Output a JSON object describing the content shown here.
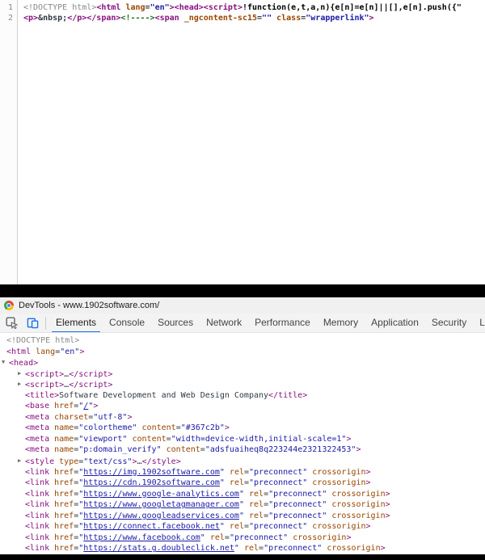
{
  "source_view": {
    "lines": [
      {
        "n": "1",
        "segs": [
          [
            "d",
            "<!DOCTYPE html>"
          ],
          [
            "t",
            "<html "
          ],
          [
            "a",
            "lang"
          ],
          [
            "x",
            "="
          ],
          [
            "v",
            "\"en\""
          ],
          [
            "t",
            "><head><script>"
          ],
          [
            "b",
            "!function(e,t,a,n){e[n]=e[n]||[],e[n].push({\""
          ]
        ]
      },
      {
        "n": "2",
        "segs": [
          [
            "t",
            "<p>"
          ],
          [
            "x",
            "&nbsp;"
          ],
          [
            "t",
            "</p></span>"
          ],
          [
            "c",
            "<!---->"
          ],
          [
            "t",
            "<span "
          ],
          [
            "a",
            "_ngcontent-sc15"
          ],
          [
            "x",
            "="
          ],
          [
            "v",
            "\"\""
          ],
          [
            "x",
            " "
          ],
          [
            "a",
            "class"
          ],
          [
            "x",
            "="
          ],
          [
            "v",
            "\"wrapperlink\""
          ],
          [
            "t",
            ">"
          ]
        ]
      }
    ]
  },
  "titlebar": {
    "title": "DevTools - www.1902software.com/",
    "icon": "chrome-logo-icon"
  },
  "tabbar": {
    "icons": [
      {
        "name": "inspect-element-icon",
        "color": "#5f6368"
      },
      {
        "name": "device-toolbar-icon",
        "color": "#1a73e8"
      }
    ],
    "tabs": [
      {
        "label": "Elements",
        "selected": true
      },
      {
        "label": "Console"
      },
      {
        "label": "Sources"
      },
      {
        "label": "Network"
      },
      {
        "label": "Performance"
      },
      {
        "label": "Memory"
      },
      {
        "label": "Application"
      },
      {
        "label": "Security"
      },
      {
        "label": "Lighthouse"
      }
    ],
    "accent_color": "#1a73e8"
  },
  "elements_panel": {
    "rows": [
      {
        "pl": 8,
        "arrow": "",
        "segs": [
          [
            "d",
            "<!DOCTYPE html>"
          ]
        ]
      },
      {
        "pl": 8,
        "arrow": "",
        "segs": [
          [
            "t",
            "<html "
          ],
          [
            "a",
            "lang"
          ],
          [
            "x",
            "="
          ],
          [
            "v",
            "\"en\""
          ],
          [
            "t",
            ">"
          ]
        ]
      },
      {
        "pl": 2,
        "arrow": "v",
        "segs": [
          [
            "t",
            "<head>"
          ]
        ]
      },
      {
        "pl": 22,
        "arrow": ">",
        "segs": [
          [
            "t",
            "<script>"
          ],
          [
            "x",
            "…"
          ],
          [
            "t",
            "</script>"
          ]
        ]
      },
      {
        "pl": 22,
        "arrow": ">",
        "segs": [
          [
            "t",
            "<script>"
          ],
          [
            "x",
            "…"
          ],
          [
            "t",
            "</script>"
          ]
        ]
      },
      {
        "pl": 31,
        "arrow": "",
        "segs": [
          [
            "t",
            "<title>"
          ],
          [
            "x",
            "Software Development and Web Design Company"
          ],
          [
            "t",
            "</title>"
          ]
        ]
      },
      {
        "pl": 31,
        "arrow": "",
        "segs": [
          [
            "t",
            "<base "
          ],
          [
            "a",
            "href"
          ],
          [
            "x",
            "="
          ],
          [
            "v",
            "\""
          ],
          [
            "l",
            "/"
          ],
          [
            "v",
            "\""
          ],
          [
            "t",
            ">"
          ]
        ]
      },
      {
        "pl": 31,
        "arrow": "",
        "segs": [
          [
            "t",
            "<meta "
          ],
          [
            "a",
            "charset"
          ],
          [
            "x",
            "="
          ],
          [
            "v",
            "\"utf-8\""
          ],
          [
            "t",
            ">"
          ]
        ]
      },
      {
        "pl": 31,
        "arrow": "",
        "segs": [
          [
            "t",
            "<meta "
          ],
          [
            "a",
            "name"
          ],
          [
            "x",
            "="
          ],
          [
            "v",
            "\"colortheme\""
          ],
          [
            "x",
            " "
          ],
          [
            "a",
            "content"
          ],
          [
            "x",
            "="
          ],
          [
            "v",
            "\"#367c2b\""
          ],
          [
            "t",
            ">"
          ]
        ]
      },
      {
        "pl": 31,
        "arrow": "",
        "segs": [
          [
            "t",
            "<meta "
          ],
          [
            "a",
            "name"
          ],
          [
            "x",
            "="
          ],
          [
            "v",
            "\"viewport\""
          ],
          [
            "x",
            " "
          ],
          [
            "a",
            "content"
          ],
          [
            "x",
            "="
          ],
          [
            "v",
            "\"width=device-width,initial-scale=1\""
          ],
          [
            "t",
            ">"
          ]
        ]
      },
      {
        "pl": 31,
        "arrow": "",
        "segs": [
          [
            "t",
            "<meta "
          ],
          [
            "a",
            "name"
          ],
          [
            "x",
            "="
          ],
          [
            "v",
            "\"p:domain_verify\""
          ],
          [
            "x",
            " "
          ],
          [
            "a",
            "content"
          ],
          [
            "x",
            "="
          ],
          [
            "v",
            "\"adsfuaiheq8q223244e2321322453\""
          ],
          [
            "t",
            ">"
          ]
        ]
      },
      {
        "pl": 22,
        "arrow": ">",
        "segs": [
          [
            "t",
            "<style "
          ],
          [
            "a",
            "type"
          ],
          [
            "x",
            "="
          ],
          [
            "v",
            "\"text/css\""
          ],
          [
            "t",
            ">"
          ],
          [
            "x",
            "…"
          ],
          [
            "t",
            "</style>"
          ]
        ]
      },
      {
        "pl": 31,
        "arrow": "",
        "segs": [
          [
            "t",
            "<link "
          ],
          [
            "a",
            "href"
          ],
          [
            "x",
            "="
          ],
          [
            "v",
            "\""
          ],
          [
            "l",
            "https://img.1902software.com"
          ],
          [
            "v",
            "\""
          ],
          [
            "x",
            " "
          ],
          [
            "a",
            "rel"
          ],
          [
            "x",
            "="
          ],
          [
            "v",
            "\"preconnect\""
          ],
          [
            "x",
            " "
          ],
          [
            "a",
            "crossorigin"
          ],
          [
            "t",
            ">"
          ]
        ]
      },
      {
        "pl": 31,
        "arrow": "",
        "segs": [
          [
            "t",
            "<link "
          ],
          [
            "a",
            "href"
          ],
          [
            "x",
            "="
          ],
          [
            "v",
            "\""
          ],
          [
            "l",
            "https://cdn.1902software.com"
          ],
          [
            "v",
            "\""
          ],
          [
            "x",
            " "
          ],
          [
            "a",
            "rel"
          ],
          [
            "x",
            "="
          ],
          [
            "v",
            "\"preconnect\""
          ],
          [
            "x",
            " "
          ],
          [
            "a",
            "crossorigin"
          ],
          [
            "t",
            ">"
          ]
        ]
      },
      {
        "pl": 31,
        "arrow": "",
        "segs": [
          [
            "t",
            "<link "
          ],
          [
            "a",
            "href"
          ],
          [
            "x",
            "="
          ],
          [
            "v",
            "\""
          ],
          [
            "l",
            "https://www.google-analytics.com"
          ],
          [
            "v",
            "\""
          ],
          [
            "x",
            " "
          ],
          [
            "a",
            "rel"
          ],
          [
            "x",
            "="
          ],
          [
            "v",
            "\"preconnect\""
          ],
          [
            "x",
            " "
          ],
          [
            "a",
            "crossorigin"
          ],
          [
            "t",
            ">"
          ]
        ]
      },
      {
        "pl": 31,
        "arrow": "",
        "segs": [
          [
            "t",
            "<link "
          ],
          [
            "a",
            "href"
          ],
          [
            "x",
            "="
          ],
          [
            "v",
            "\""
          ],
          [
            "l",
            "https://www.googletagmanager.com"
          ],
          [
            "v",
            "\""
          ],
          [
            "x",
            " "
          ],
          [
            "a",
            "rel"
          ],
          [
            "x",
            "="
          ],
          [
            "v",
            "\"preconnect\""
          ],
          [
            "x",
            " "
          ],
          [
            "a",
            "crossorigin"
          ],
          [
            "t",
            ">"
          ]
        ]
      },
      {
        "pl": 31,
        "arrow": "",
        "segs": [
          [
            "t",
            "<link "
          ],
          [
            "a",
            "href"
          ],
          [
            "x",
            "="
          ],
          [
            "v",
            "\""
          ],
          [
            "l",
            "https://www.googleadservices.com"
          ],
          [
            "v",
            "\""
          ],
          [
            "x",
            " "
          ],
          [
            "a",
            "rel"
          ],
          [
            "x",
            "="
          ],
          [
            "v",
            "\"preconnect\""
          ],
          [
            "x",
            " "
          ],
          [
            "a",
            "crossorigin"
          ],
          [
            "t",
            ">"
          ]
        ]
      },
      {
        "pl": 31,
        "arrow": "",
        "segs": [
          [
            "t",
            "<link "
          ],
          [
            "a",
            "href"
          ],
          [
            "x",
            "="
          ],
          [
            "v",
            "\""
          ],
          [
            "l",
            "https://connect.facebook.net"
          ],
          [
            "v",
            "\""
          ],
          [
            "x",
            " "
          ],
          [
            "a",
            "rel"
          ],
          [
            "x",
            "="
          ],
          [
            "v",
            "\"preconnect\""
          ],
          [
            "x",
            " "
          ],
          [
            "a",
            "crossorigin"
          ],
          [
            "t",
            ">"
          ]
        ]
      },
      {
        "pl": 31,
        "arrow": "",
        "segs": [
          [
            "t",
            "<link "
          ],
          [
            "a",
            "href"
          ],
          [
            "x",
            "="
          ],
          [
            "v",
            "\""
          ],
          [
            "l",
            "https://www.facebook.com"
          ],
          [
            "v",
            "\""
          ],
          [
            "x",
            " "
          ],
          [
            "a",
            "rel"
          ],
          [
            "x",
            "="
          ],
          [
            "v",
            "\"preconnect\""
          ],
          [
            "x",
            " "
          ],
          [
            "a",
            "crossorigin"
          ],
          [
            "t",
            ">"
          ]
        ]
      },
      {
        "pl": 31,
        "arrow": "",
        "segs": [
          [
            "t",
            "<link "
          ],
          [
            "a",
            "href"
          ],
          [
            "x",
            "="
          ],
          [
            "v",
            "\""
          ],
          [
            "l",
            "https://stats.g.doubleclick.net"
          ],
          [
            "v",
            "\""
          ],
          [
            "x",
            " "
          ],
          [
            "a",
            "rel"
          ],
          [
            "x",
            "="
          ],
          [
            "v",
            "\"preconnect\""
          ],
          [
            "x",
            " "
          ],
          [
            "a",
            "crossorigin"
          ],
          [
            "t",
            ">"
          ]
        ]
      }
    ]
  },
  "colors": {
    "tag": "#881280",
    "attribute_name": "#994500",
    "attribute_value": "#1a1aa6",
    "doctype": "#888888",
    "comment": "#236e25",
    "accent_blue": "#1a73e8",
    "titlebar_bg": "#f0f0f0",
    "tabbar_bg": "#f3f3f3"
  }
}
